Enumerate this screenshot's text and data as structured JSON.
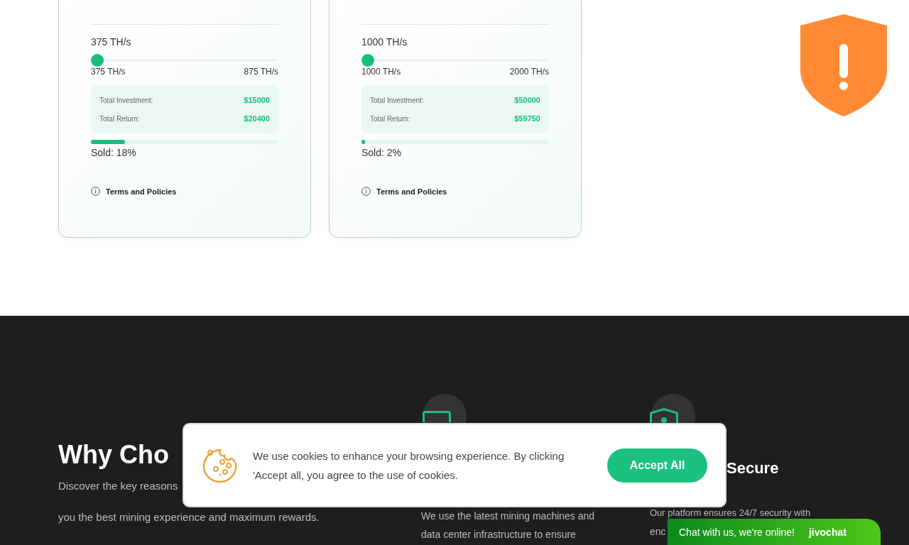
{
  "plans": [
    {
      "hashrate": "375 TH/s",
      "slider": {
        "level": 0,
        "min": "375 TH/s",
        "max": "875 TH/s"
      },
      "investment_label": "Total Investment:",
      "investment": "$15000",
      "return_label": "Total Return:",
      "return": "$20400",
      "sold": {
        "level": 0.18,
        "label": "Sold: 18%"
      },
      "terms": "Terms and Policies"
    },
    {
      "hashrate": "1000 TH/s",
      "slider": {
        "level": 0,
        "min": "1000 TH/s",
        "max": "2000 TH/s"
      },
      "investment_label": "Total Investment:",
      "investment": "$50000",
      "return_label": "Total Return:",
      "return": "$59750",
      "sold": {
        "level": 0.02,
        "label": "Sold: 2%"
      },
      "terms": "Terms and Policies"
    }
  ],
  "why": {
    "heading": "Why Cho",
    "lines": [
      "Discover the key reasons",
      "you the best mining experience and maximum rewards."
    ],
    "features": [
      {
        "kind": "monitor",
        "lines": [
          "We use the latest mining machines and",
          "data center infrastructure to ensure"
        ]
      },
      {
        "kind": "shield",
        "heading": "Secure",
        "lines": [
          "Our platform ensures 24/7 security with",
          "enc"
        ]
      }
    ]
  },
  "cookie": {
    "text": "We use cookies to enhance your browsing experience. By clicking 'Accept all, you agree to the use of cookies.",
    "button": "Accept All"
  },
  "chat": {
    "text": "Chat with us, we're online!",
    "brand": "jivochat"
  }
}
